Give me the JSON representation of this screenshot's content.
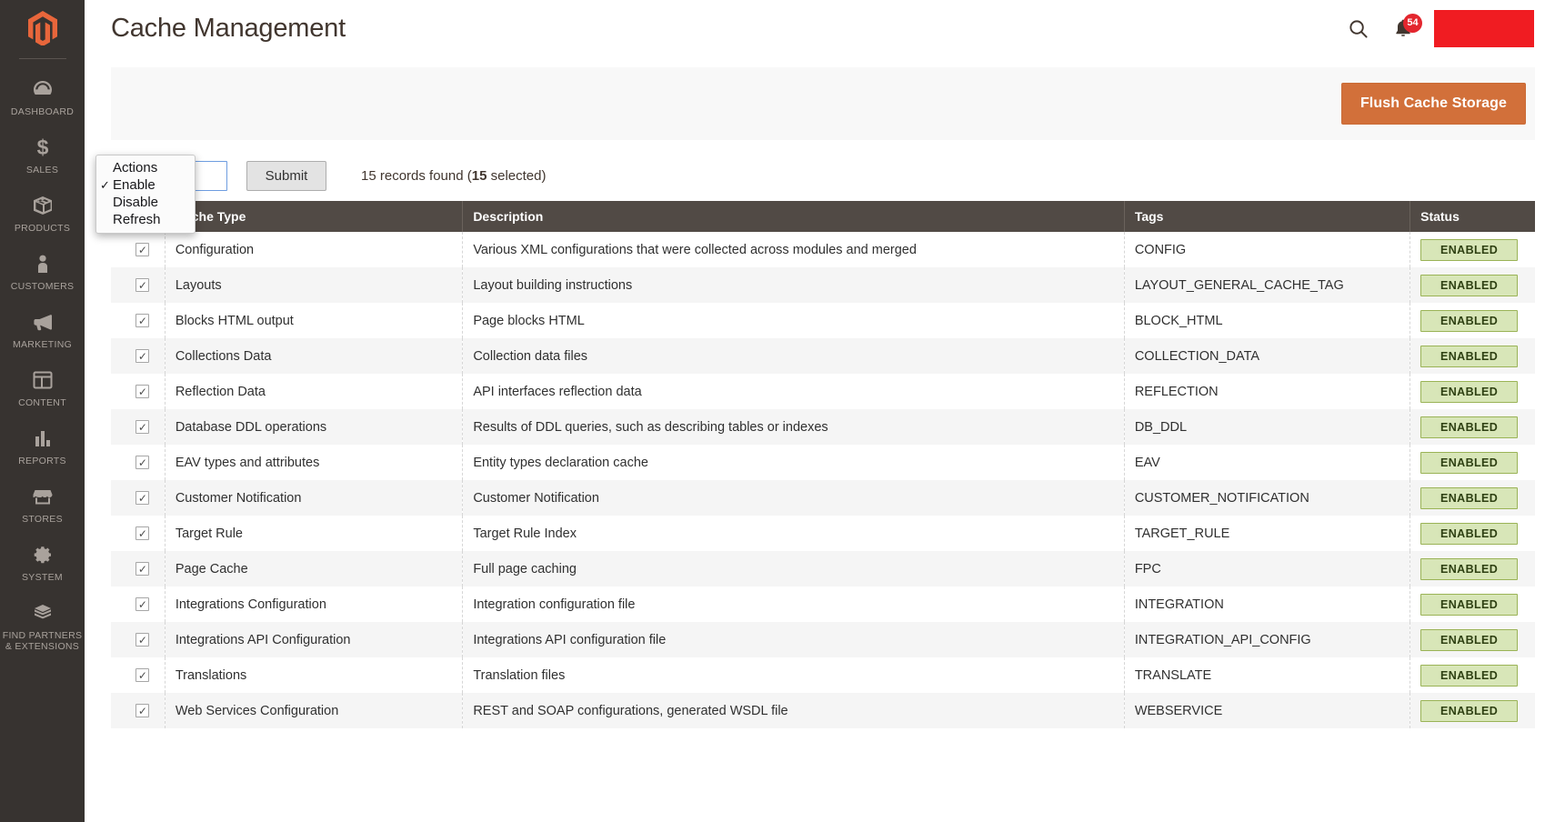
{
  "sidebar": {
    "logo_icon": "magento-logo-icon",
    "items": [
      {
        "label": "DASHBOARD",
        "icon": "dashboard-icon"
      },
      {
        "label": "SALES",
        "icon": "dollar-icon"
      },
      {
        "label": "PRODUCTS",
        "icon": "box-icon"
      },
      {
        "label": "CUSTOMERS",
        "icon": "person-icon"
      },
      {
        "label": "MARKETING",
        "icon": "megaphone-icon"
      },
      {
        "label": "CONTENT",
        "icon": "content-icon"
      },
      {
        "label": "REPORTS",
        "icon": "bar-chart-icon"
      },
      {
        "label": "STORES",
        "icon": "storefront-icon"
      },
      {
        "label": "SYSTEM",
        "icon": "gear-icon"
      },
      {
        "label": "FIND PARTNERS\n& EXTENSIONS",
        "icon": "extension-box-icon"
      }
    ]
  },
  "header": {
    "title": "Cache Management",
    "search_icon": "search-icon",
    "notifications_icon": "bell-icon",
    "notifications_count": "54"
  },
  "toolbar": {
    "flush_label": "Flush Cache Storage",
    "flush_color": "#d2703a"
  },
  "controls": {
    "mass_action_selected": "Enable",
    "submit_label": "Submit",
    "records_prefix": "15 records found (",
    "records_count": "15",
    "records_suffix": " selected)"
  },
  "actions_popup": {
    "options": [
      {
        "label": "Actions",
        "checked": false
      },
      {
        "label": "Enable",
        "checked": true
      },
      {
        "label": "Disable",
        "checked": false
      },
      {
        "label": "Refresh",
        "checked": false
      }
    ],
    "check_glyph": "✓"
  },
  "grid": {
    "select_all_glyph": "✓",
    "row_check_glyph": "✓",
    "columns": [
      "",
      "Cache Type",
      "Description",
      "Tags",
      "Status"
    ],
    "rows": [
      {
        "checked": true,
        "type": "Configuration",
        "description": "Various XML configurations that were collected across modules and merged",
        "tags": "CONFIG",
        "status": "ENABLED"
      },
      {
        "checked": true,
        "type": "Layouts",
        "description": "Layout building instructions",
        "tags": "LAYOUT_GENERAL_CACHE_TAG",
        "status": "ENABLED"
      },
      {
        "checked": true,
        "type": "Blocks HTML output",
        "description": "Page blocks HTML",
        "tags": "BLOCK_HTML",
        "status": "ENABLED"
      },
      {
        "checked": true,
        "type": "Collections Data",
        "description": "Collection data files",
        "tags": "COLLECTION_DATA",
        "status": "ENABLED"
      },
      {
        "checked": true,
        "type": "Reflection Data",
        "description": "API interfaces reflection data",
        "tags": "REFLECTION",
        "status": "ENABLED"
      },
      {
        "checked": true,
        "type": "Database DDL operations",
        "description": "Results of DDL queries, such as describing tables or indexes",
        "tags": "DB_DDL",
        "status": "ENABLED"
      },
      {
        "checked": true,
        "type": "EAV types and attributes",
        "description": "Entity types declaration cache",
        "tags": "EAV",
        "status": "ENABLED"
      },
      {
        "checked": true,
        "type": "Customer Notification",
        "description": "Customer Notification",
        "tags": "CUSTOMER_NOTIFICATION",
        "status": "ENABLED"
      },
      {
        "checked": true,
        "type": "Target Rule",
        "description": "Target Rule Index",
        "tags": "TARGET_RULE",
        "status": "ENABLED"
      },
      {
        "checked": true,
        "type": "Page Cache",
        "description": "Full page caching",
        "tags": "FPC",
        "status": "ENABLED"
      },
      {
        "checked": true,
        "type": "Integrations Configuration",
        "description": "Integration configuration file",
        "tags": "INTEGRATION",
        "status": "ENABLED"
      },
      {
        "checked": true,
        "type": "Integrations API Configuration",
        "description": "Integrations API configuration file",
        "tags": "INTEGRATION_API_CONFIG",
        "status": "ENABLED"
      },
      {
        "checked": true,
        "type": "Translations",
        "description": "Translation files",
        "tags": "TRANSLATE",
        "status": "ENABLED"
      },
      {
        "checked": true,
        "type": "Web Services Configuration",
        "description": "REST and SOAP configurations, generated WSDL file",
        "tags": "WEBSERVICE",
        "status": "ENABLED"
      }
    ]
  }
}
